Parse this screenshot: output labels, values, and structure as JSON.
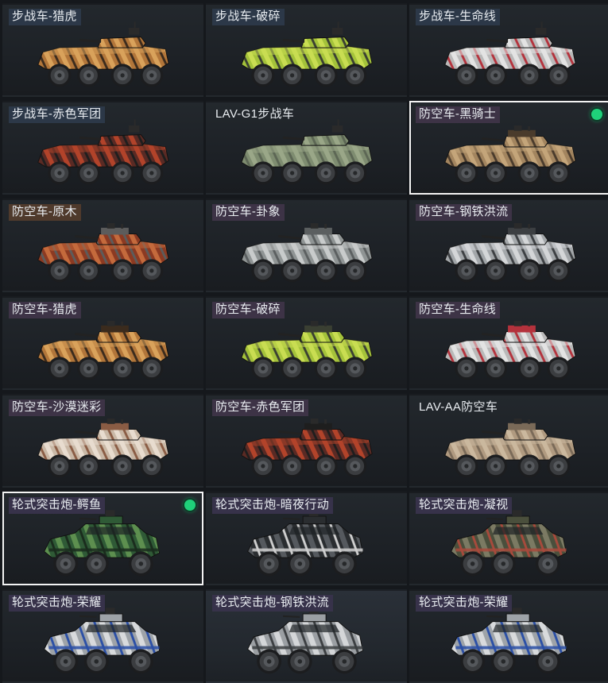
{
  "vehicles": [
    {
      "name": "步战车-猎虎",
      "kind": "ifv",
      "pattern": "tiger",
      "equipped": false,
      "label_style": "ifv"
    },
    {
      "name": "步战车-破碎",
      "kind": "ifv",
      "pattern": "shatter",
      "equipped": false,
      "label_style": "ifv"
    },
    {
      "name": "步战车-生命线",
      "kind": "ifv",
      "pattern": "lifeline",
      "equipped": false,
      "label_style": "ifv"
    },
    {
      "name": "步战车-赤色军团",
      "kind": "ifv",
      "pattern": "red",
      "equipped": false,
      "label_style": "ifv"
    },
    {
      "name": "LAV-G1步战车",
      "kind": "ifv",
      "pattern": "olive",
      "equipped": false,
      "label_style": "plain"
    },
    {
      "name": "防空车-黑骑士",
      "kind": "aa",
      "pattern": "sand",
      "equipped": true,
      "label_style": "aa"
    },
    {
      "name": "防空车-原木",
      "kind": "aa",
      "pattern": "wood",
      "equipped": false,
      "label_style": "rare"
    },
    {
      "name": "防空车-卦象",
      "kind": "aa",
      "pattern": "grey",
      "equipped": false,
      "label_style": "aa"
    },
    {
      "name": "防空车-钢铁洪流",
      "kind": "aa",
      "pattern": "steel",
      "equipped": false,
      "label_style": "aa"
    },
    {
      "name": "防空车-猎虎",
      "kind": "aa",
      "pattern": "tiger",
      "equipped": false,
      "label_style": "aa"
    },
    {
      "name": "防空车-破碎",
      "kind": "aa",
      "pattern": "shatter",
      "equipped": false,
      "label_style": "aa"
    },
    {
      "name": "防空车-生命线",
      "kind": "aa",
      "pattern": "lifeline",
      "equipped": false,
      "label_style": "aa"
    },
    {
      "name": "防空车-沙漠迷彩",
      "kind": "aa",
      "pattern": "desertcamo",
      "equipped": false,
      "label_style": "aa"
    },
    {
      "name": "防空车-赤色军团",
      "kind": "aa",
      "pattern": "red",
      "equipped": false,
      "label_style": "aa"
    },
    {
      "name": "LAV-AA防空车",
      "kind": "aa",
      "pattern": "tan",
      "equipped": false,
      "label_style": "plain"
    },
    {
      "name": "轮式突击炮-鳄鱼",
      "kind": "apc",
      "pattern": "croc",
      "equipped": true,
      "label_style": "tank"
    },
    {
      "name": "轮式突击炮-暗夜行动",
      "kind": "apc",
      "pattern": "night",
      "equipped": false,
      "label_style": "tank"
    },
    {
      "name": "轮式突击炮-凝视",
      "kind": "apc",
      "pattern": "gaze",
      "equipped": false,
      "label_style": "tank"
    },
    {
      "name": "轮式突击炮-荣耀",
      "kind": "apc",
      "pattern": "glory",
      "equipped": false,
      "label_style": "tank"
    },
    {
      "name": "轮式突击炮-钢铁洪流",
      "kind": "apc",
      "pattern": "steelapc",
      "equipped": false,
      "label_style": "tank"
    },
    {
      "name": "轮式突击炮-荣耀",
      "kind": "apc",
      "pattern": "glory",
      "equipped": false,
      "label_style": "tank"
    }
  ],
  "palettes": {
    "tiger": [
      "#b2763a",
      "#d9a25b",
      "#3b2b1d"
    ],
    "shatter": [
      "#a4c23a",
      "#c9dd52",
      "#3a3f32"
    ],
    "lifeline": [
      "#b9b9b9",
      "#e3e3e3",
      "#b4323c"
    ],
    "red": [
      "#5a2a24",
      "#b2432a",
      "#1e1e1e"
    ],
    "olive": [
      "#7e8c70",
      "#9aa788",
      "#5c6654"
    ],
    "sand": [
      "#a3855f",
      "#c4a57a",
      "#4a3b2c"
    ],
    "wood": [
      "#8c3a22",
      "#c46a3c",
      "#5c5c5c"
    ],
    "grey": [
      "#8f9494",
      "#c8cbcb",
      "#5b5f60"
    ],
    "steel": [
      "#a3a7aa",
      "#d4d6d8",
      "#3c3f42"
    ],
    "desertcamo": [
      "#c9b8a6",
      "#e8dccf",
      "#8a5c44"
    ],
    "tan": [
      "#b09a80",
      "#cbb89e",
      "#7a6a58"
    ],
    "croc": [
      "#2f5a36",
      "#5d8f4f",
      "#1a2c1d"
    ],
    "night": [
      "#2a2d30",
      "#55595e",
      "#cfcfcf"
    ],
    "gaze": [
      "#4a4f3c",
      "#7b7a63",
      "#a84a3c"
    ],
    "glory": [
      "#9ea3a8",
      "#d8dadc",
      "#2a4fa6"
    ],
    "steelapc": [
      "#9b9fa3",
      "#d4d6d8",
      "#3b3e41"
    ]
  }
}
